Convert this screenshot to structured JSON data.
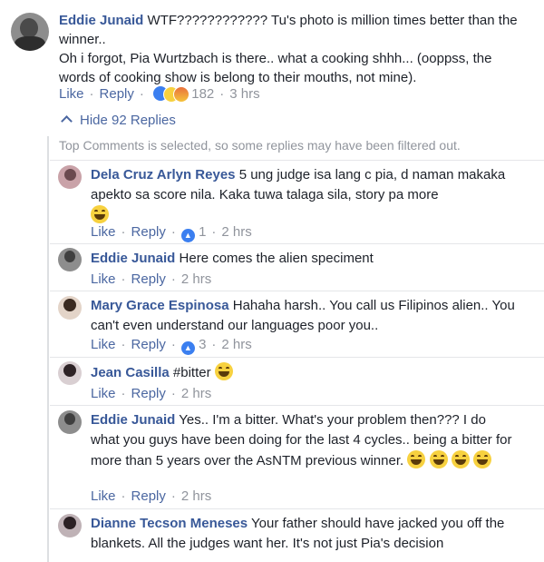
{
  "main_comment": {
    "author": "Eddie Junaid",
    "text": "WTF???????????? Tu's photo is million times better than the winner..\nOh i forgot, Pia Wurtzbach is there.. what a cooking shhh... (ooppss, the words of cooking show is belong to their mouths, not mine).",
    "like_label": "Like",
    "reply_label": "Reply",
    "reaction_count": "182",
    "time": "3 hrs"
  },
  "replies_toggle": {
    "label": "Hide 92 Replies"
  },
  "filter_notice": "Top Comments is selected, so some replies may have been filtered out.",
  "replies": [
    {
      "author": "Dela Cruz Arlyn Reyes",
      "text": "5 ung judge isa lang c pia, d naman makaka apekto sa score nila. Kaka tuwa talaga sila, story pa more",
      "like_label": "Like",
      "reply_label": "Reply",
      "likes": "1",
      "time": "2 hrs"
    },
    {
      "author": "Eddie Junaid",
      "text": "Here comes the alien speciment",
      "like_label": "Like",
      "reply_label": "Reply",
      "time": "2 hrs"
    },
    {
      "author": "Mary Grace Espinosa",
      "text": "Hahaha harsh.. You call us Filipinos alien.. You can't even understand our languages poor you..",
      "like_label": "Like",
      "reply_label": "Reply",
      "likes": "3",
      "time": "2 hrs"
    },
    {
      "author": "Jean Casilla",
      "text": "#bitter",
      "like_label": "Like",
      "reply_label": "Reply",
      "time": "2 hrs"
    },
    {
      "author": "Eddie Junaid",
      "text": "Yes.. I'm a bitter. What's your problem then??? I do what you guys have been doing for the last 4 cycles.. being a bitter for more than 5 years over the AsNTM previous winner.",
      "like_label": "Like",
      "reply_label": "Reply",
      "time": "2 hrs"
    },
    {
      "author": "Dianne Tecson Meneses",
      "text": "Your father should have jacked you off the blankets. All the judges want her. It's not just Pia's decision"
    }
  ],
  "colors": {
    "link": "#385898",
    "meta": "#90949c",
    "like_blue": "#3b7ff0",
    "haha_yellow": "#f7d13f"
  }
}
